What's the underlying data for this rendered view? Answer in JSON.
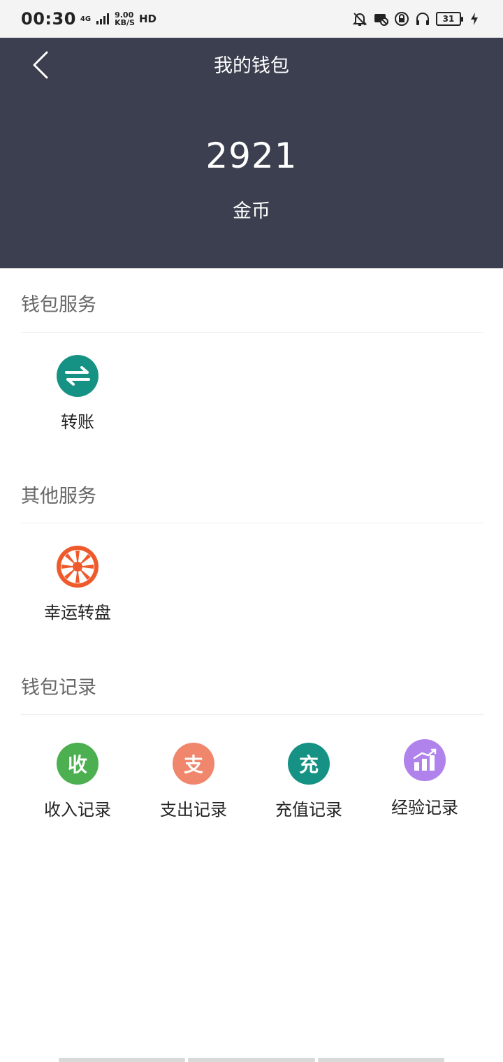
{
  "status_bar": {
    "time": "00:30",
    "network_type": "4G",
    "speed_value": "9.00",
    "speed_unit": "KB/S",
    "hd": "HD",
    "battery": "31"
  },
  "header": {
    "title": "我的钱包",
    "balance": "2921",
    "unit": "金币"
  },
  "sections": {
    "wallet_service": {
      "title": "钱包服务",
      "items": [
        {
          "label": "转账",
          "icon": "transfer-arrows-icon",
          "color": "#169284"
        }
      ]
    },
    "other_service": {
      "title": "其他服务",
      "items": [
        {
          "label": "幸运转盘",
          "icon": "lucky-wheel-icon",
          "color": "#ee5a2b"
        }
      ]
    },
    "wallet_records": {
      "title": "钱包记录",
      "items": [
        {
          "label": "收入记录",
          "glyph": "收",
          "icon": "income-icon",
          "color": "#4caf50"
        },
        {
          "label": "支出记录",
          "glyph": "支",
          "icon": "expense-icon",
          "color": "#f0866b"
        },
        {
          "label": "充值记录",
          "glyph": "充",
          "icon": "recharge-icon",
          "color": "#169284"
        },
        {
          "label": "经验记录",
          "icon": "experience-chart-icon",
          "color": "#b083ec"
        }
      ]
    }
  },
  "colors": {
    "header_bg": "#3b3f4f",
    "section_title": "#666666"
  }
}
